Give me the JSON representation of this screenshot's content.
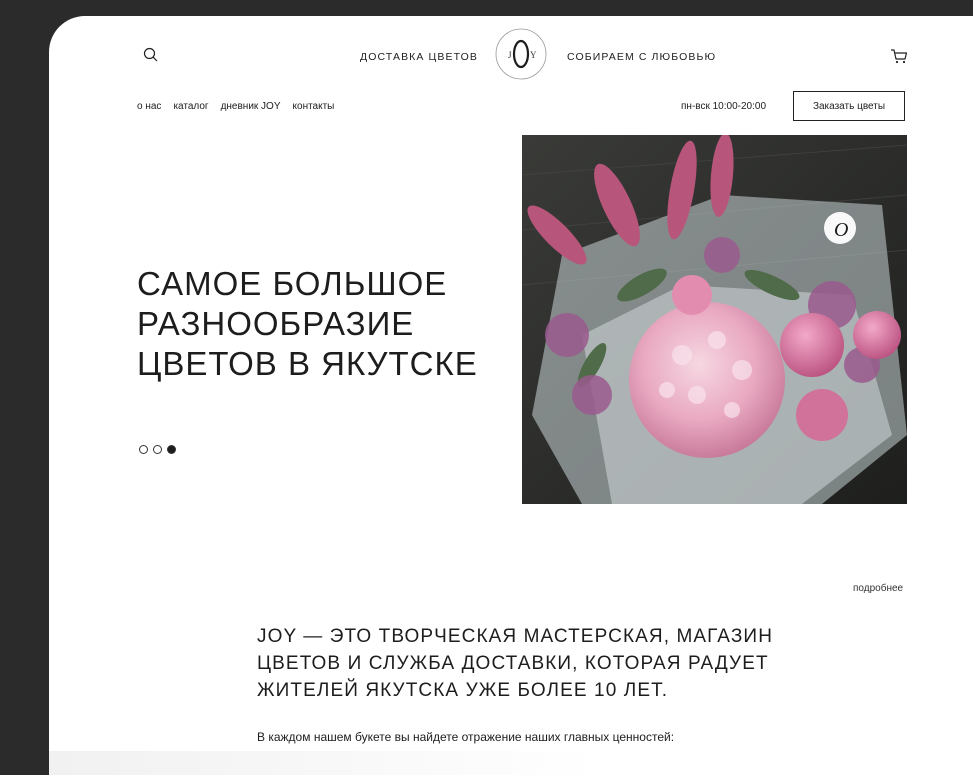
{
  "header": {
    "nav_left": "ДОСТАВКА ЦВЕТОВ",
    "nav_right": "СОБИРАЕМ С ЛЮБОВЬЮ",
    "logo_letters": {
      "left": "J",
      "center": "O",
      "right": "Y"
    },
    "icons": [
      "search-icon",
      "cart-icon"
    ]
  },
  "menu": {
    "items": [
      {
        "label": "о нас"
      },
      {
        "label": "каталог"
      },
      {
        "label": "дневник JOY"
      },
      {
        "label": "контакты"
      }
    ],
    "hours": "пн-вск 10:00-20:00",
    "order_button": "Заказать цветы"
  },
  "hero": {
    "title_lines": [
      "САМОЕ БОЛЬШОЕ",
      "РАЗНООБРАЗИЕ",
      "ЦВЕТОВ В ЯКУТСКЕ"
    ],
    "slides_total": 3,
    "active_slide": 3,
    "photo_badge": "O"
  },
  "about": {
    "more_link": "подробнее",
    "title_lines": [
      "JOY — ЭТО ТВОРЧЕСКАЯ МАСТЕРСКАЯ, МАГАЗИН",
      "ЦВЕТОВ И СЛУЖБА ДОСТАВКИ, КОТОРАЯ РАДУЕТ",
      "ЖИТЕЛЕЙ ЯКУТСКА УЖЕ БОЛЕЕ 10 ЛЕТ."
    ],
    "text": "В каждом нашем букете вы найдете отражение наших главных ценностей:"
  },
  "colors": {
    "page_bg": "#2b2b2b",
    "card_bg": "#ffffff",
    "text": "#1d1d1d"
  }
}
